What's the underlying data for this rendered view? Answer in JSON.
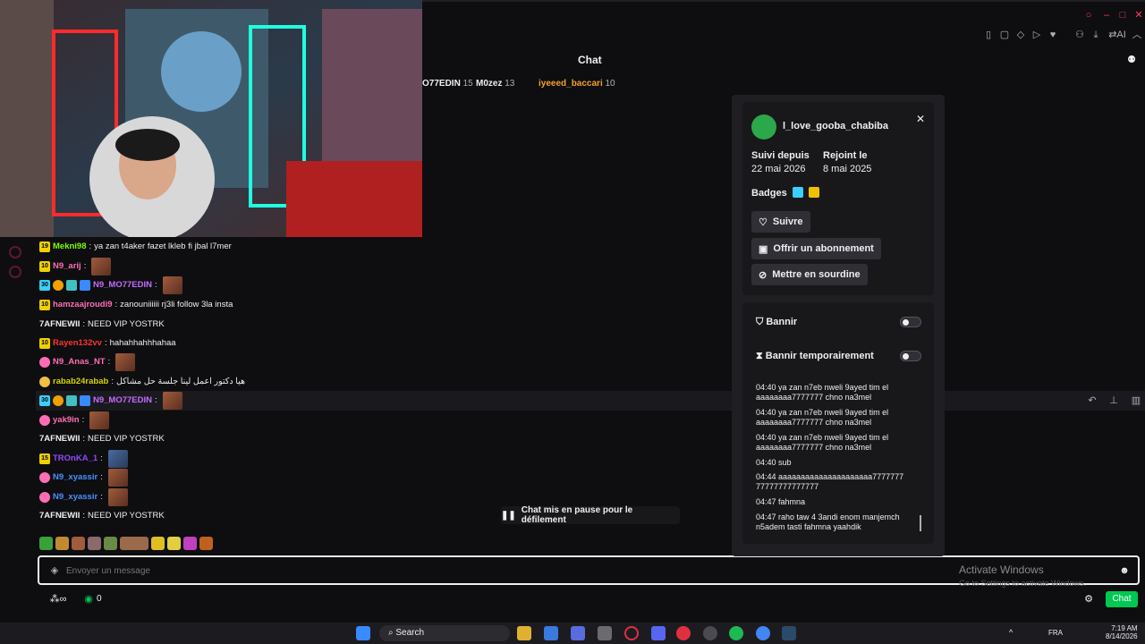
{
  "chat": {
    "title": "Chat"
  },
  "leaderboard": [
    {
      "name": "O77EDIN",
      "count": "15"
    },
    {
      "name": "M0zez",
      "count": "13"
    },
    {
      "name": "iyeeed_baccari",
      "count": "10"
    }
  ],
  "messages": [
    {
      "badge": "19",
      "user": "Mekni98",
      "color": "#7cfc00",
      "text": "ya zan t4aker fazet lkleb fi jbal l7mer",
      "emote": false
    },
    {
      "badge": "10",
      "user": "N9_arij",
      "color": "#ff6eb4",
      "text": "",
      "emote": true
    },
    {
      "badge": "30",
      "user": "N9_MO77EDIN",
      "color": "#c46cff",
      "text": "",
      "emote": true
    },
    {
      "badge": "10",
      "user": "hamzaajroudi9",
      "color": "#ff6eb4",
      "text": "zanouniiiiii rj3li follow 3la insta",
      "emote": false
    },
    {
      "badge": "",
      "user": "7AFNEWII",
      "color": "#efeff1",
      "text": "NEED VIP YOSTRK",
      "emote": false
    },
    {
      "badge": "10",
      "user": "Rayen132vv",
      "color": "#ff3333",
      "text": "hahahhahhhahaa",
      "emote": false
    },
    {
      "badge": "",
      "user": "N9_Anas_NT",
      "color": "#ff6eb4",
      "text": "",
      "emote": true
    },
    {
      "badge": "",
      "user": "rabab24rabab",
      "color": "#d4d400",
      "text": "هيا دكتور اعمل لينا جلسة حل مشاكل",
      "emote": false
    },
    {
      "badge": "30",
      "user": "N9_MO77EDIN",
      "color": "#c46cff",
      "text": "",
      "emote": true
    },
    {
      "badge": "",
      "user": "yak9in",
      "color": "#ff6eb4",
      "text": "",
      "emote": true
    },
    {
      "badge": "",
      "user": "7AFNEWII",
      "color": "#efeff1",
      "text": "NEED VIP YOSTRK",
      "emote": false
    },
    {
      "badge": "15",
      "user": "TROnKA_1",
      "color": "#9147ff",
      "text": "",
      "emote": true
    },
    {
      "badge": "",
      "user": "N9_xyassir",
      "color": "#4a90ff",
      "text": "",
      "emote": true
    },
    {
      "badge": "",
      "user": "N9_xyassir",
      "color": "#4a90ff",
      "text": "",
      "emote": true
    },
    {
      "badge": "",
      "user": "7AFNEWII",
      "color": "#efeff1",
      "text": "NEED VIP YOSTRK",
      "emote": false
    }
  ],
  "pause_label": "Chat mis en pause pour le défilement",
  "input": {
    "placeholder": "Envoyer un message"
  },
  "bottom": {
    "count": "0",
    "chat_button": "Chat"
  },
  "watermark": {
    "line1": "Activate Windows",
    "line2": "Go to Settings to activate Windows."
  },
  "card": {
    "username": "l_love_gooba_chabiba",
    "followed_label": "Suivi depuis",
    "followed_date": "22 mai 2026",
    "joined_label": "Rejoint le",
    "joined_date": "8 mai 2025",
    "badges_label": "Badges",
    "follow_button": "Suivre",
    "gift_button": "Offrir un abonnement",
    "mute_button": "Mettre en sourdine",
    "ban_label": "Bannir",
    "timeout_label": "Bannir temporairement",
    "log": [
      "04:40 ya zan n7eb nweli 9ayed tim el aaaaaaaa7777777 chno na3mel",
      "04:40 ya zan n7eb nweli 9ayed tim el aaaaaaaa7777777 chno na3mel",
      "04:40 ya zan n7eb nweli 9ayed tim el aaaaaaaa7777777 chno na3mel",
      "04:40 sub",
      "04:44 aaaaaaaaaaaaaaaaaaaaa7777777 77777777777777",
      "04:47 fahmna",
      "04:47 raho taw 4 3andi enom manjemch n5adem tasti fahmna yaahdik"
    ]
  },
  "taskbar": {
    "search": "Search",
    "lang": "FRA",
    "time": "7:19 AM",
    "date": "8/14/2026"
  }
}
